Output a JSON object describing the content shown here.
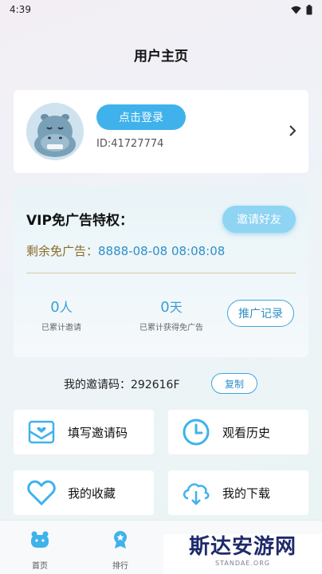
{
  "status_bar": {
    "time": "4:39"
  },
  "header": {
    "title": "用户主页"
  },
  "profile": {
    "login_label": "点击登录",
    "user_id": "ID:41727774"
  },
  "vip": {
    "title": "VIP免广告特权：",
    "invite_label": "邀请好友",
    "remaining_label": "剩余免广告：",
    "remaining_value": "8888-08-08 08:08:08",
    "stats": [
      {
        "value": "0",
        "unit": "人",
        "caption": "已累计邀请"
      },
      {
        "value": "0",
        "unit": "天",
        "caption": "已累计获得免广告"
      }
    ],
    "record_label": "推广记录"
  },
  "invite_code": {
    "label": "我的邀请码：292616F",
    "copy_label": "复制"
  },
  "tiles": [
    {
      "label": "填写邀请码",
      "icon": "envelope-heart-icon"
    },
    {
      "label": "观看历史",
      "icon": "clock-icon"
    },
    {
      "label": "我的收藏",
      "icon": "heart-icon"
    },
    {
      "label": "我的下载",
      "icon": "cloud-download-icon"
    }
  ],
  "bottom_nav": [
    {
      "label": "首页",
      "icon": "home-hippo-icon"
    },
    {
      "label": "排行",
      "icon": "ranking-badge-icon"
    }
  ],
  "watermark": {
    "main": "斯达安游网",
    "sub": "STANDAE.ORG"
  },
  "colors": {
    "accent": "#3fb2ec",
    "accent_text": "#2f8fc7",
    "gold_text": "#8a6a2a"
  }
}
